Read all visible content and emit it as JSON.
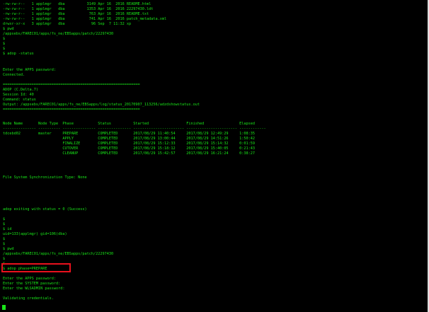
{
  "terminal": {
    "colors": {
      "background": "#000000",
      "text": "#19e619",
      "highlight": "#e8111d"
    },
    "lines": [
      "-rw-rw-r--   1 applmgr   dba          3149 Apr 16  2016 README.html",
      "-rw-rw-r--   1 applmgr   dba          1353 Apr 16  2016 22297430.ldt",
      "-rw-rw-r--   1 applmgr   dba           763 Apr 16  2016 README.txt",
      "-rw-rw-r--   1 applmgr   dba           741 Apr 16  2016 patch_metadata.xml",
      "drwxr-xr-x   3 applmgr   dba            96 Sep  7 11:32 xp",
      "$ pwd",
      "/appsebs/FAREC01/apps/fs_ne/EBSapps/patch/22297430",
      "$",
      "$",
      "$",
      "$ adop -status",
      "Enter the APPS password:",
      "Connected.",
      "==============================================================",
      "ADOP (C.Delta.7)",
      "Session Id: 40",
      "Command: status",
      "Output: /appsebs/FAREC01/apps/fs_ne/EBSapps/log/status_20170907_113256/adzdshowstatus.out",
      "==============================================================",
      "Node Name       Node Type  Phase           Status          Started                 Finished                Elapsed",
      "--------------- ---------- --------------- --------------- ----------------------- ----------------------- ------------",
      "tdcebd02        master     PREPARE         COMPLETED       2017/08/29 11:40:54     2017/08/29 12:49:29     1:08:35",
      "                           APPLY           COMPLETED       2017/08/29 13:00:44     2017/08/29 14:51:26     1:50:42",
      "                           FINALIZE        COMPLETED       2017/08/29 15:12:33     2017/08/29 15:14:32     0:01:59",
      "                           CUTOVER         COMPLETED       2017/08/29 15:18:12     2017/08/29 15:40:05     0:21:43",
      "                           CLEANUP         COMPLETED       2017/08/29 15:42:57     2017/08/29 16:21:24     0:38:27",
      "File System Synchronization Type: None",
      "adop exiting with status = 0 (Success)",
      "$",
      "$",
      "$ id",
      "uid=133(applmgr) gid=106(dba)",
      "$",
      "$",
      "$ pwd",
      "/appsebs/FAREC01/apps/fs_ne/EBSapps/patch/22297430",
      "$",
      "$",
      "$ adop phase=PREPARE",
      "Enter the APPS password:",
      "Enter the SYSTEM password:",
      "Enter the WLSADMIN password:",
      "Validating credentials."
    ]
  }
}
